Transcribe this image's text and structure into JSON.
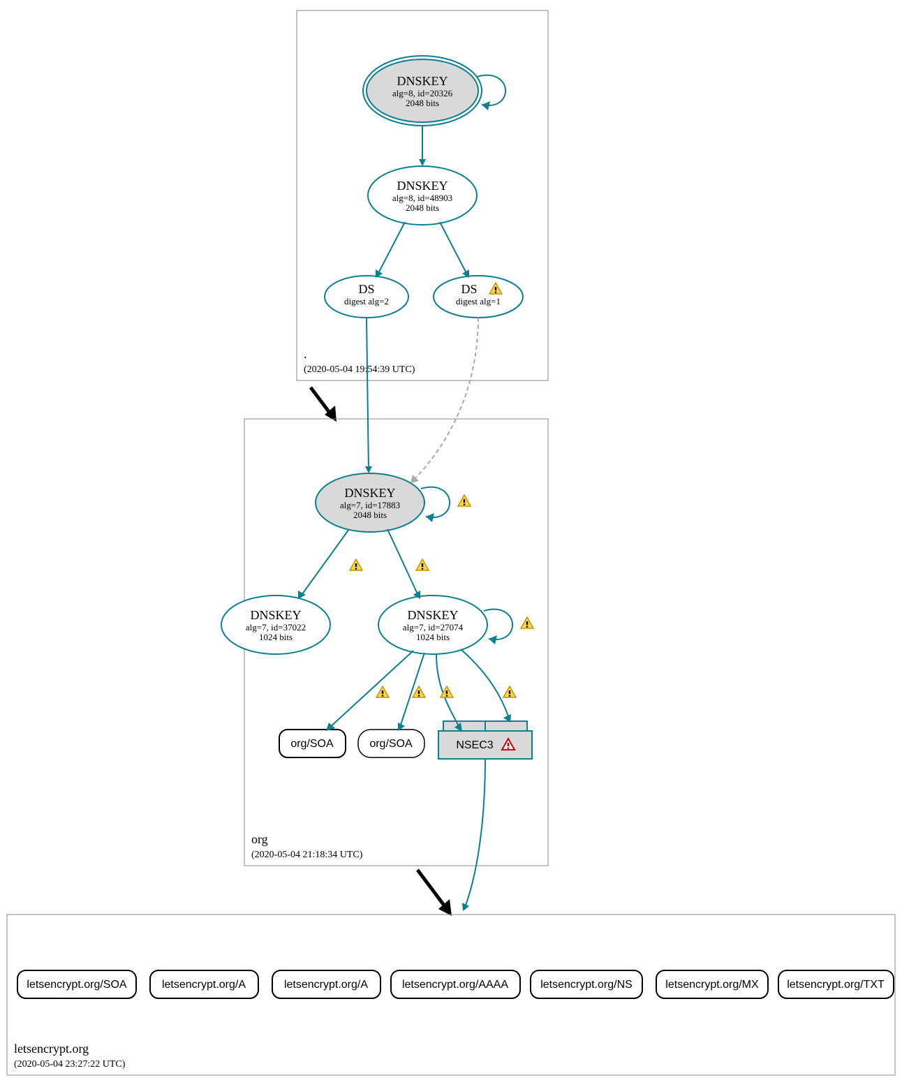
{
  "zones": {
    "root": {
      "name": ".",
      "timestamp": "(2020-05-04 19:54:39 UTC)"
    },
    "org": {
      "name": "org",
      "timestamp": "(2020-05-04 21:18:34 UTC)"
    },
    "letsencrypt": {
      "name": "letsencrypt.org",
      "timestamp": "(2020-05-04 23:27:22 UTC)"
    }
  },
  "nodes": {
    "root_ksk": {
      "title": "DNSKEY",
      "line1": "alg=8, id=20326",
      "line2": "2048 bits"
    },
    "root_zsk": {
      "title": "DNSKEY",
      "line1": "alg=8, id=48903",
      "line2": "2048 bits"
    },
    "ds1": {
      "title": "DS",
      "line1": "digest alg=2"
    },
    "ds2": {
      "title": "DS",
      "line1": "digest alg=1"
    },
    "org_ksk": {
      "title": "DNSKEY",
      "line1": "alg=7, id=17883",
      "line2": "2048 bits"
    },
    "org_zsk1": {
      "title": "DNSKEY",
      "line1": "alg=7, id=37022",
      "line2": "1024 bits"
    },
    "org_zsk2": {
      "title": "DNSKEY",
      "line1": "alg=7, id=27074",
      "line2": "1024 bits"
    },
    "org_soa1": {
      "label": "org/SOA"
    },
    "org_soa2": {
      "label": "org/SOA"
    },
    "nsec3": {
      "label": "NSEC3"
    }
  },
  "rrsets": [
    "letsencrypt.org/SOA",
    "letsencrypt.org/A",
    "letsencrypt.org/A",
    "letsencrypt.org/AAAA",
    "letsencrypt.org/NS",
    "letsencrypt.org/MX",
    "letsencrypt.org/TXT"
  ],
  "colors": {
    "teal": "#0a7f8f",
    "gray_fill": "#d9d9d9"
  }
}
